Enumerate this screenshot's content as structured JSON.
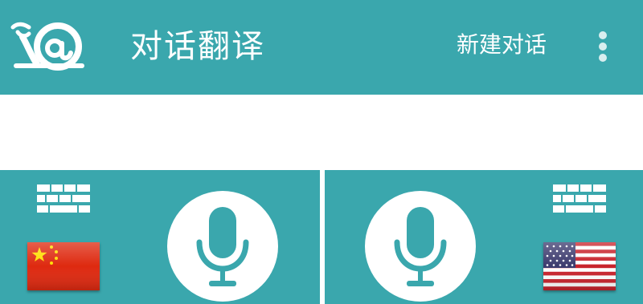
{
  "header": {
    "title": "对话翻译",
    "new_chat_label": "新建对话",
    "logo_icon": "snail-at-logo-icon",
    "menu_icon": "more-vert-icon"
  },
  "colors": {
    "accent": "#3aa7ad",
    "background": "#ffffff",
    "mic_glyph": "#3aa7ad"
  },
  "translation_area": {
    "text": ""
  },
  "left_panel": {
    "keyboard_icon": "keyboard-icon",
    "mic_icon": "microphone-icon",
    "flag_icon": "china-flag-icon"
  },
  "right_panel": {
    "keyboard_icon": "keyboard-icon",
    "mic_icon": "microphone-icon",
    "flag_icon": "usa-flag-icon"
  }
}
